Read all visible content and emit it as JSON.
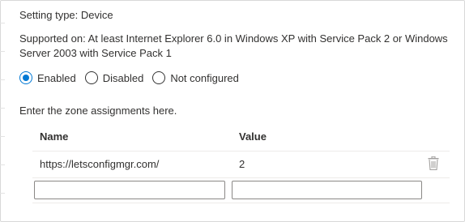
{
  "header": {
    "setting_type": "Setting type: Device",
    "supported_on": "Supported on: At least Internet Explorer 6.0 in Windows XP with Service Pack 2 or Windows Server 2003 with Service Pack 1"
  },
  "state_options": {
    "selected": "Enabled",
    "enabled_label": "Enabled",
    "disabled_label": "Disabled",
    "not_configured_label": "Not configured"
  },
  "zones": {
    "title": "Enter the zone assignments here.",
    "columns": {
      "name": "Name",
      "value": "Value"
    },
    "rows": [
      {
        "name": "https://letsconfigmgr.com/",
        "value": "2"
      }
    ],
    "new_entry": {
      "name": "",
      "value": ""
    }
  },
  "colors": {
    "accent": "#0078d4",
    "border": "#8a8886",
    "divider": "#edebe9",
    "text": "#323130"
  },
  "icons": {
    "delete": "trash-icon"
  }
}
